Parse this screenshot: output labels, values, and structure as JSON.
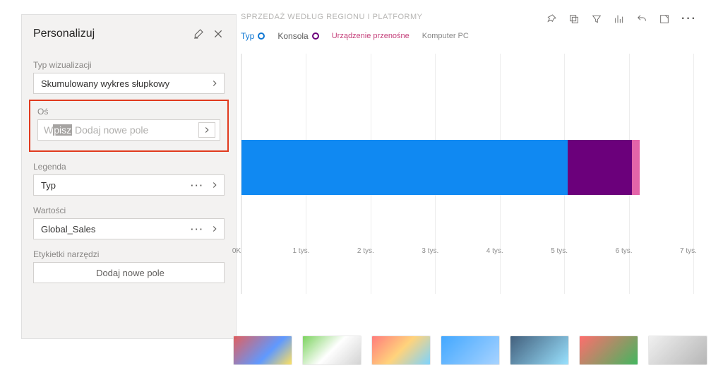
{
  "panel": {
    "title": "Personalizuj",
    "viz_type_label": "Typ wizualizacji",
    "viz_type_value": "Skumulowany wykres słupkowy",
    "axis_label": "Oś",
    "axis_placeholder_leading": "W",
    "axis_placeholder_selected": "pisz",
    "axis_placeholder_trailing": "Dodaj nowe pole",
    "legend_label": "Legenda",
    "legend_value": "Typ",
    "values_label": "Wartości",
    "values_value": "Global_Sales",
    "tooltips_label": "Etykietki narzędzi",
    "add_field": "Dodaj nowe pole"
  },
  "chart": {
    "title": "SPRZEDAŻ WEDŁUG REGIONU I PLATFORMY",
    "legend_series_label": "Typ",
    "legend_items": [
      {
        "label": "Konsola",
        "color_class": "purple"
      },
      {
        "label": "Urządzenie przenośne",
        "color_class": "pink"
      },
      {
        "label": "Komputer PC",
        "color_class": "gray"
      }
    ],
    "x_ticks": [
      "0K",
      "1 tys.",
      "2 tys.",
      "3 tys.",
      "4 tys.",
      "5 tys.",
      "6 tys.",
      "7 tys."
    ]
  },
  "chart_data": {
    "type": "bar",
    "orientation": "horizontal",
    "stacked": true,
    "title": "SPRZEDAŻ WEDŁUG REGIONU I PLATFORMY",
    "xlabel": "",
    "ylabel": "",
    "xlim": [
      0,
      7000
    ],
    "categories": [
      ""
    ],
    "series": [
      {
        "name": "Konsola",
        "values": [
          5050
        ],
        "color": "#1089f2"
      },
      {
        "name": "Urządzenie przenośne",
        "values": [
          1000
        ],
        "color": "#6b007b"
      },
      {
        "name": "Komputer PC",
        "values": [
          120
        ],
        "color": "#e364a9"
      }
    ],
    "x_ticks": [
      0,
      1000,
      2000,
      3000,
      4000,
      5000,
      6000,
      7000
    ],
    "x_tick_labels": [
      "0K",
      "1 tys.",
      "2 tys.",
      "3 tys.",
      "4 tys.",
      "5 tys.",
      "6 tys.",
      "7 tys."
    ]
  }
}
